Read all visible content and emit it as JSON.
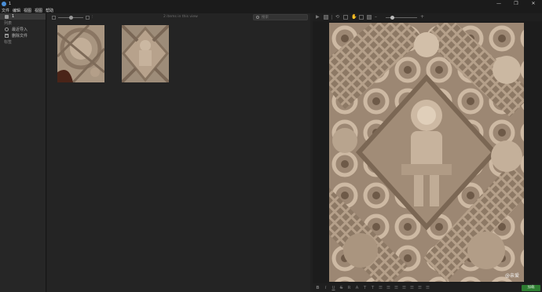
{
  "window": {
    "title": "1",
    "minimize": "—",
    "maximize": "❐",
    "close": "✕"
  },
  "menu": [
    "文件",
    "编辑",
    "视图",
    "视图",
    "帮助"
  ],
  "sidebar": {
    "folder_name": "1",
    "section_label": "列表",
    "recent_label": "最近导入",
    "trash_label": "删除文件",
    "tags_label": "标签"
  },
  "grid": {
    "items_count": "2 items in this view",
    "search_placeholder": "搜索"
  },
  "viewer": {
    "watermark": "@亲爱"
  },
  "footer": {
    "format_buttons": [
      "B",
      "I",
      "U",
      "S",
      "R",
      "A",
      "T",
      "T",
      "☰",
      "☰",
      "☰",
      "☰",
      "☰",
      "☰",
      "☰"
    ],
    "status_button": "加载"
  },
  "colors": {
    "accent": "#4a8fd8",
    "status_green": "#2e7d32",
    "stone": "#b9a28a"
  }
}
